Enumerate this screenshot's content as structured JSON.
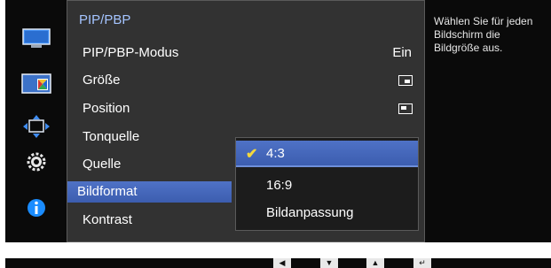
{
  "menu": {
    "title": "PIP/PBP",
    "items": [
      {
        "label": "PIP/PBP-Modus",
        "value": "Ein"
      },
      {
        "label": "Größe"
      },
      {
        "label": "Position"
      },
      {
        "label": "Tonquelle"
      },
      {
        "label": "Quelle"
      },
      {
        "label": "Bildformat"
      },
      {
        "label": "Kontrast"
      }
    ]
  },
  "submenu": {
    "options": [
      "4:3",
      "16:9",
      "Bildanpassung"
    ],
    "selected": "4:3"
  },
  "help_text": "Wählen Sie für jeden Bildschirm die Bildgröße aus.",
  "colors": {
    "highlight": "#4f72c6",
    "title": "#a4c4ff",
    "check": "#f4d83c",
    "info": "#1a8cff"
  },
  "side_icons": [
    "monitor-icon",
    "pip-pbp-icon",
    "move-icon",
    "gear-icon",
    "info-icon"
  ],
  "nav_keys": [
    "left-arrow-key",
    "down-arrow-key",
    "up-arrow-key",
    "enter-key"
  ]
}
